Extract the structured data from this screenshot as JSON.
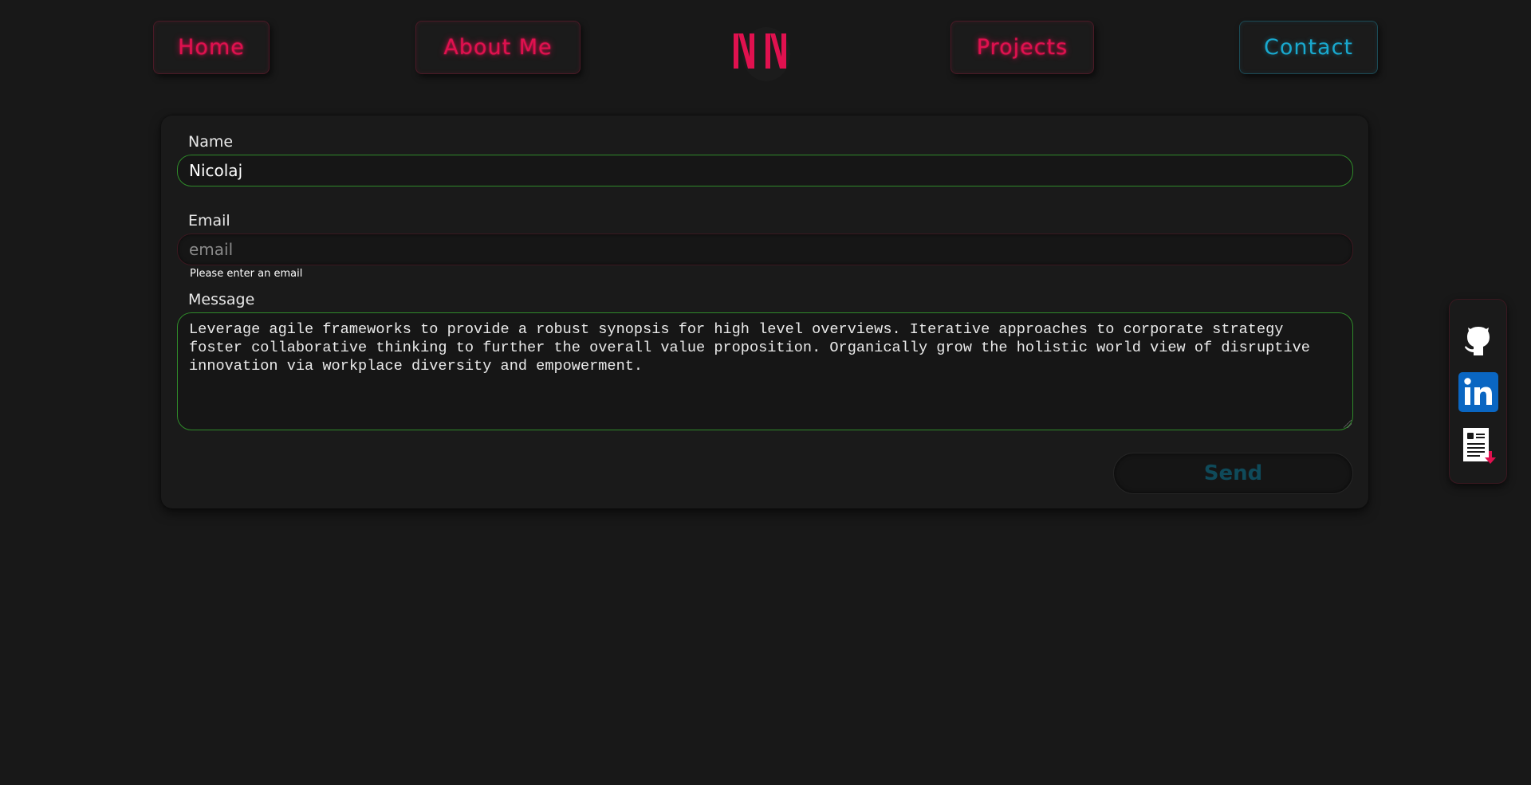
{
  "nav": {
    "home": "Home",
    "about": "About Me",
    "projects": "Projects",
    "contact": "Contact",
    "active": "contact"
  },
  "logo": {
    "text": "NN",
    "color": "#e0114f"
  },
  "form": {
    "name_label": "Name",
    "name_value": "Nicolaj",
    "email_label": "Email",
    "email_value": "",
    "email_placeholder": "email",
    "email_error": "Please enter an email",
    "message_label": "Message",
    "message_value": "Leverage agile frameworks to provide a robust synopsis for high level overviews. Iterative approaches to corporate strategy foster collaborative thinking to further the overall value proposition. Organically grow the holistic world view of disruptive innovation via workplace diversity and empowerment.",
    "send_label": "Send"
  },
  "social": {
    "icons": [
      "github-icon",
      "linkedin-icon",
      "resume-download-icon"
    ]
  },
  "colors": {
    "background": "#181818",
    "accent_pink": "#e0114f",
    "accent_cyan": "#19a9cf",
    "valid_border": "#2f8a2a",
    "linkedin_blue": "#0a66c2"
  }
}
